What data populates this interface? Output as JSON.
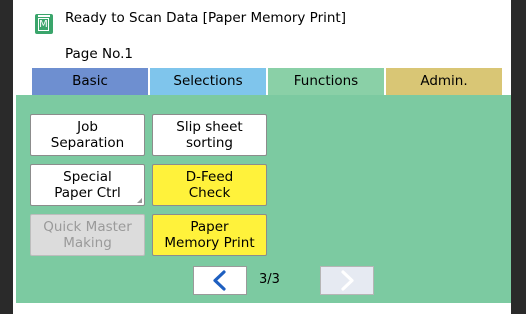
{
  "header": {
    "status_text": "Ready to Scan Data [Paper Memory Print]",
    "page_label": "Page No.1",
    "status_icon": "memory-icon",
    "icon_letter": "M"
  },
  "tabs": [
    {
      "label": "Basic",
      "color": "#6e8fd0"
    },
    {
      "label": "Selections",
      "color": "#7fc5ec"
    },
    {
      "label": "Functions",
      "color": "#8ad0a7",
      "selected": true
    },
    {
      "label": "Admin.",
      "color": "#d9c675"
    }
  ],
  "functions": {
    "job_separation": {
      "line1": "Job",
      "line2": "Separation"
    },
    "slip_sheet_sorting": {
      "line1": "Slip sheet",
      "line2": "sorting"
    },
    "special_paper_ctrl": {
      "line1": "Special",
      "line2": "Paper Ctrl"
    },
    "d_feed_check": {
      "line1": "D-Feed",
      "line2": "Check"
    },
    "quick_master_making": {
      "line1": "Quick Master",
      "line2": "Making",
      "disabled": true
    },
    "paper_memory_print": {
      "line1": "Paper",
      "line2": "Memory Print"
    }
  },
  "pager": {
    "page_count": "3/3",
    "prev_icon": "chevron-left-icon",
    "next_icon": "chevron-right-icon"
  },
  "colors": {
    "panel": "#7ccaa1",
    "highlight": "#fff23b",
    "accent": "#1e5fc0"
  }
}
